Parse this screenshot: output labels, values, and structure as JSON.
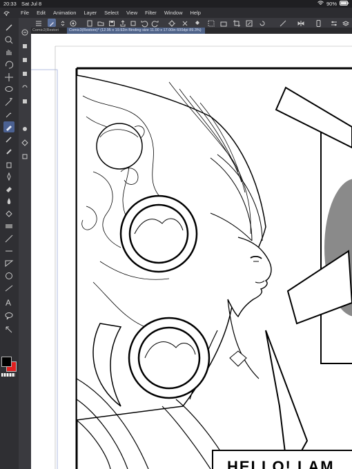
{
  "status": {
    "time": "20:33",
    "date": "Sat Jul 8",
    "battery": "90%"
  },
  "menu": [
    "File",
    "Edit",
    "Animation",
    "Layer",
    "Select",
    "View",
    "Filter",
    "Window",
    "Help"
  ],
  "tabs": [
    {
      "label": "Comic2(Restori"
    },
    {
      "label": "Comic3(Restore)* (12.95 x 19.92in Binding size 11.00 x 17.00in 600dpi 89.3%)"
    }
  ],
  "speech_text": "HELLO! I AM",
  "colors": {
    "main": "#000000",
    "sub": "#e02020",
    "accent": "#4f6389"
  }
}
